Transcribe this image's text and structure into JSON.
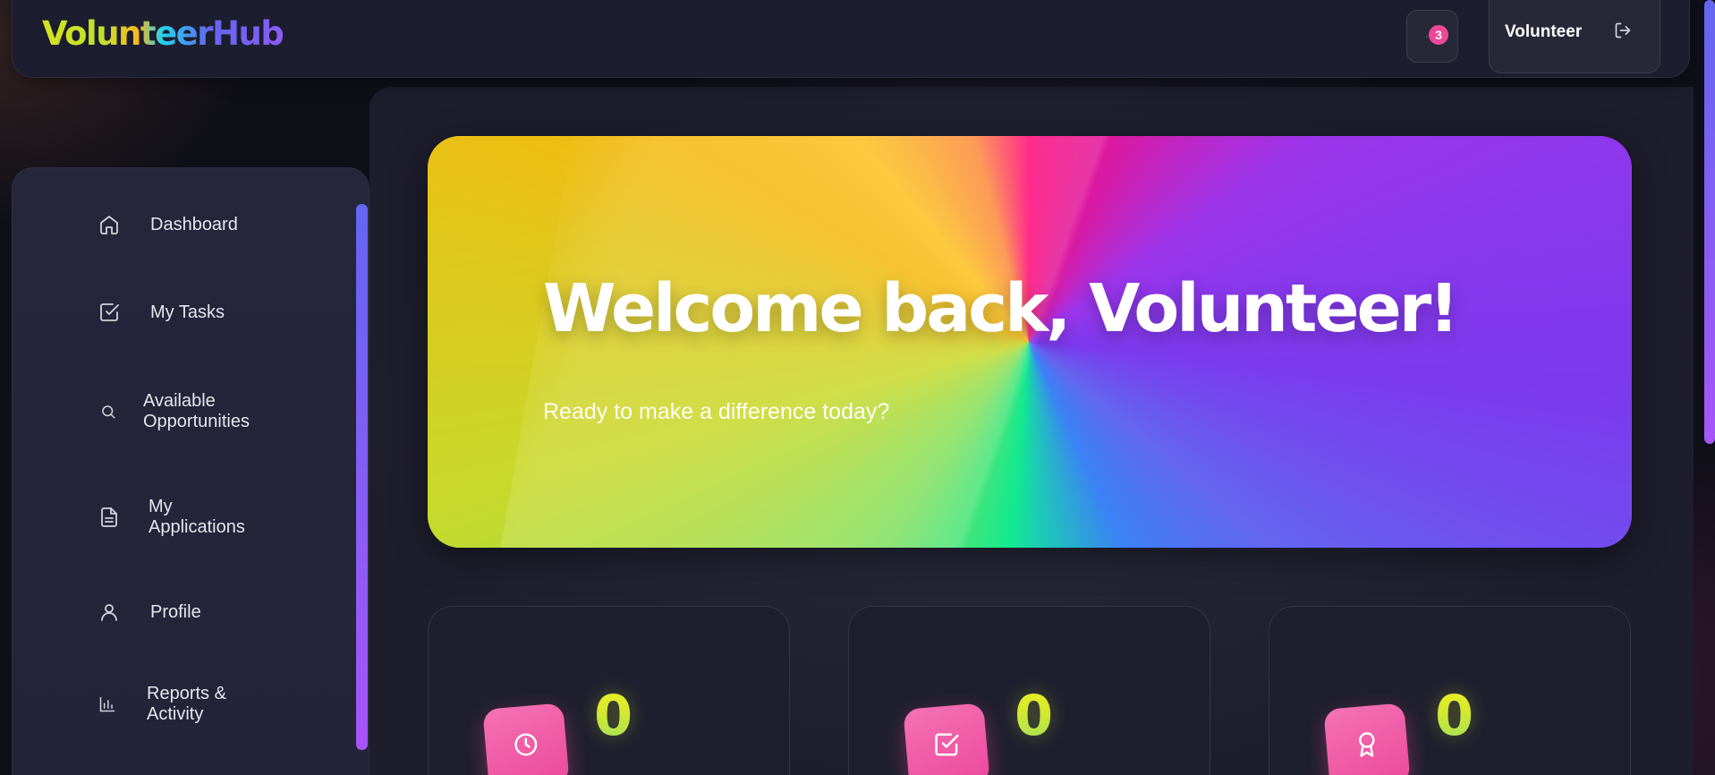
{
  "header": {
    "logo": "VolunteerHub",
    "notifications_count": "3",
    "user_name": "Volunteer"
  },
  "sidebar": {
    "items": [
      {
        "label": "Dashboard",
        "icon": "home-icon"
      },
      {
        "label": "My Tasks",
        "icon": "checkbox-icon"
      },
      {
        "label": "Available Opportunities",
        "icon": "search-icon"
      },
      {
        "label": "My Applications",
        "icon": "document-icon"
      },
      {
        "label": "Profile",
        "icon": "user-icon"
      },
      {
        "label": "Reports & Activity",
        "icon": "bar-chart-icon"
      }
    ]
  },
  "hero": {
    "title": "Welcome back, Volunteer!",
    "subtitle": "Ready to make a difference today?"
  },
  "stats": [
    {
      "value": "0",
      "icon": "clock-icon"
    },
    {
      "value": "0",
      "icon": "check-square-icon"
    },
    {
      "value": "0",
      "icon": "award-icon"
    }
  ],
  "colors": {
    "accent_pink": "#ec4899",
    "accent_purple": "#7c3aed",
    "sidebar_bg": "#25253c",
    "page_bg": "#0f0f18"
  }
}
